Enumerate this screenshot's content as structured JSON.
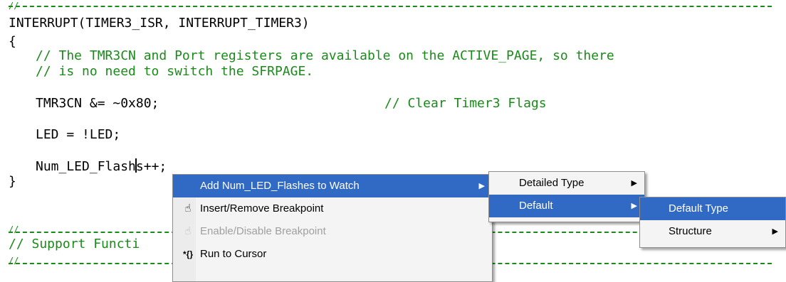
{
  "editor": {
    "sep_top": "//",
    "line_sig": "INTERRUPT(TIMER3_ISR, INTERRUPT_TIMER3)",
    "brace_open": "{",
    "comment1": "// The TMR3CN and Port registers are available on the ACTIVE_PAGE, so there",
    "comment2": "// is no need to switch the SFRPAGE.",
    "stmt1_code": "TMR3CN &= ~0x80;",
    "stmt1_comment": "// Clear Timer3 Flags",
    "stmt2": "LED = !LED;",
    "stmt3_before": "Num_LED_Flash",
    "stmt3_after": "s++;",
    "brace_close": "}",
    "sep2": "//",
    "support_comment": "// Support Functi",
    "sep3": "//",
    "comment_color": "#1a8a1a"
  },
  "context_menu": {
    "items": [
      {
        "label": "Add Num_LED_Flashes to Watch",
        "icon": "",
        "selected": true,
        "disabled": false,
        "submenu": true
      },
      {
        "label": "Insert/Remove Breakpoint",
        "icon": "hand-icon",
        "selected": false,
        "disabled": false,
        "submenu": false
      },
      {
        "label": "Enable/Disable Breakpoint",
        "icon": "hand-icon",
        "selected": false,
        "disabled": true,
        "submenu": false
      },
      {
        "label": "Run to Cursor",
        "icon": "run-to-cursor-icon",
        "selected": false,
        "disabled": false,
        "submenu": false
      }
    ],
    "icons": {
      "hand": "☝",
      "run": "*{}"
    }
  },
  "submenu_watch": {
    "items": [
      {
        "label": "Detailed Type",
        "selected": false,
        "submenu": true
      },
      {
        "label": "Default",
        "selected": true,
        "submenu": true
      }
    ]
  },
  "submenu_default": {
    "items": [
      {
        "label": "Default Type",
        "selected": true,
        "submenu": false
      },
      {
        "label": "Structure",
        "selected": false,
        "submenu": true
      }
    ]
  },
  "arrow_glyph": "▶",
  "selection_color": "#316ac5"
}
